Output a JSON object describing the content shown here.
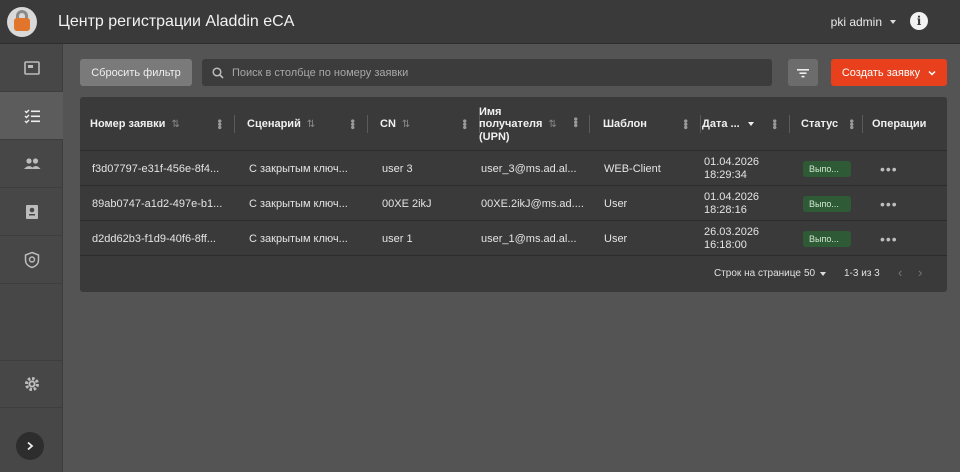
{
  "header": {
    "title": "Центр регистрации Aladdin eCA",
    "user": "pki admin"
  },
  "toolbar": {
    "reset_label": "Сбросить фильтр",
    "search_placeholder": "Поиск в столбце по номеру заявки",
    "create_label": "Создать заявку"
  },
  "table": {
    "columns": {
      "number": "Номер заявки",
      "scenario": "Сценарий",
      "cn": "CN",
      "recipient": [
        "Имя",
        "получателя",
        "(UPN)"
      ],
      "template": "Шаблон",
      "date": "Дата ...",
      "status": "Статус",
      "ops": "Операции"
    },
    "rows": [
      {
        "number": "f3d07797-e31f-456e-8f4...",
        "scenario": "С закрытым ключ...",
        "cn": "user 3",
        "upn": "user_3@ms.ad.al...",
        "template": "WEB-Client",
        "date": "01.04.2026",
        "time": "18:29:34",
        "status": "Выпо..."
      },
      {
        "number": "89ab0747-a1d2-497e-b1...",
        "scenario": "С закрытым ключ...",
        "cn": "00XE 2ikJ",
        "upn": "00XE.2ikJ@ms.ad....",
        "template": "User",
        "date": "01.04.2026",
        "time": "18:28:16",
        "status": "Выпо..."
      },
      {
        "number": "d2dd62b3-f1d9-40f6-8ff...",
        "scenario": "С закрытым ключ...",
        "cn": "user 1",
        "upn": "user_1@ms.ad.al...",
        "template": "User",
        "date": "26.03.2026",
        "time": "16:18:00",
        "status": "Выпо..."
      }
    ]
  },
  "pagination": {
    "rows_label": "Строк на странице",
    "rows_value": "50",
    "range": "1-3 из 3"
  },
  "colors": {
    "accent": "#e8401c",
    "status_ok": "#2f5a36"
  }
}
